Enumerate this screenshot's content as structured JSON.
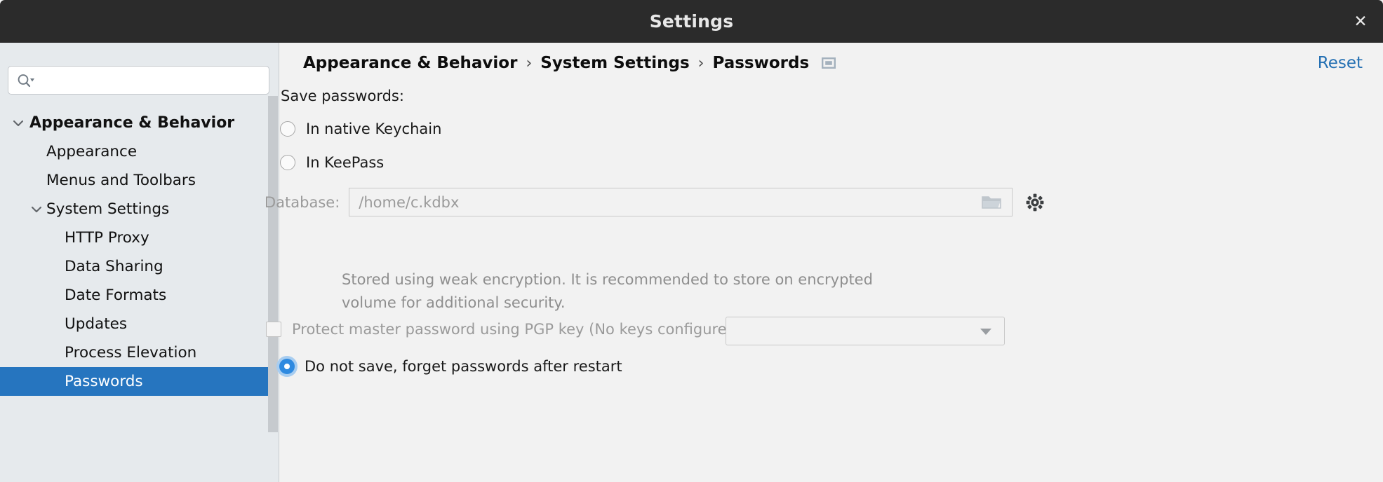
{
  "window": {
    "title": "Settings",
    "close_label": "✕"
  },
  "sidebar": {
    "search": {
      "value": "",
      "placeholder": "",
      "icon": "search-icon"
    },
    "items": [
      {
        "label": "Appearance & Behavior",
        "depth": 0,
        "expandable": true,
        "expanded": true,
        "selected": false
      },
      {
        "label": "Appearance",
        "depth": 1,
        "expandable": false,
        "expanded": false,
        "selected": false
      },
      {
        "label": "Menus and Toolbars",
        "depth": 1,
        "expandable": false,
        "expanded": false,
        "selected": false
      },
      {
        "label": "System Settings",
        "depth": 1,
        "expandable": true,
        "expanded": true,
        "selected": false
      },
      {
        "label": "HTTP Proxy",
        "depth": 2,
        "expandable": false,
        "expanded": false,
        "selected": false
      },
      {
        "label": "Data Sharing",
        "depth": 2,
        "expandable": false,
        "expanded": false,
        "selected": false
      },
      {
        "label": "Date Formats",
        "depth": 2,
        "expandable": false,
        "expanded": false,
        "selected": false
      },
      {
        "label": "Updates",
        "depth": 2,
        "expandable": false,
        "expanded": false,
        "selected": false
      },
      {
        "label": "Process Elevation",
        "depth": 2,
        "expandable": false,
        "expanded": false,
        "selected": false
      },
      {
        "label": "Passwords",
        "depth": 2,
        "expandable": false,
        "expanded": false,
        "selected": true
      }
    ]
  },
  "content": {
    "breadcrumb": {
      "crumbs": [
        "Appearance & Behavior",
        "System Settings",
        "Passwords"
      ],
      "separator": "›",
      "trailing_icon": "window-icon"
    },
    "reset_label": "Reset",
    "section_label": "Save passwords:",
    "options": [
      {
        "label": "In native Keychain",
        "selected": false
      },
      {
        "label": "In KeePass",
        "selected": false
      },
      {
        "label": "Do not save, forget passwords after restart",
        "selected": true
      }
    ],
    "database": {
      "label": "Database:",
      "value": "/home/c.kdbx",
      "placeholder": "",
      "browse_icon": "folder-icon",
      "settings_icon": "gear-icon",
      "disabled": true
    },
    "hint": "Stored using weak encryption. It is recommended to store on encrypted volume for additional security.",
    "pgp": {
      "label": "Protect master password using PGP key (No keys configured)",
      "checked": false,
      "disabled": true,
      "dropdown_value": ""
    }
  },
  "colors": {
    "titlebar_bg": "#2b2b2b",
    "sidebar_bg": "#e6eaed",
    "content_bg": "#f2f2f2",
    "selection_blue": "#2675bf",
    "link_blue": "#2470b3",
    "radio_blue": "#2f8ae0",
    "disabled_gray": "#9a9a9a"
  }
}
